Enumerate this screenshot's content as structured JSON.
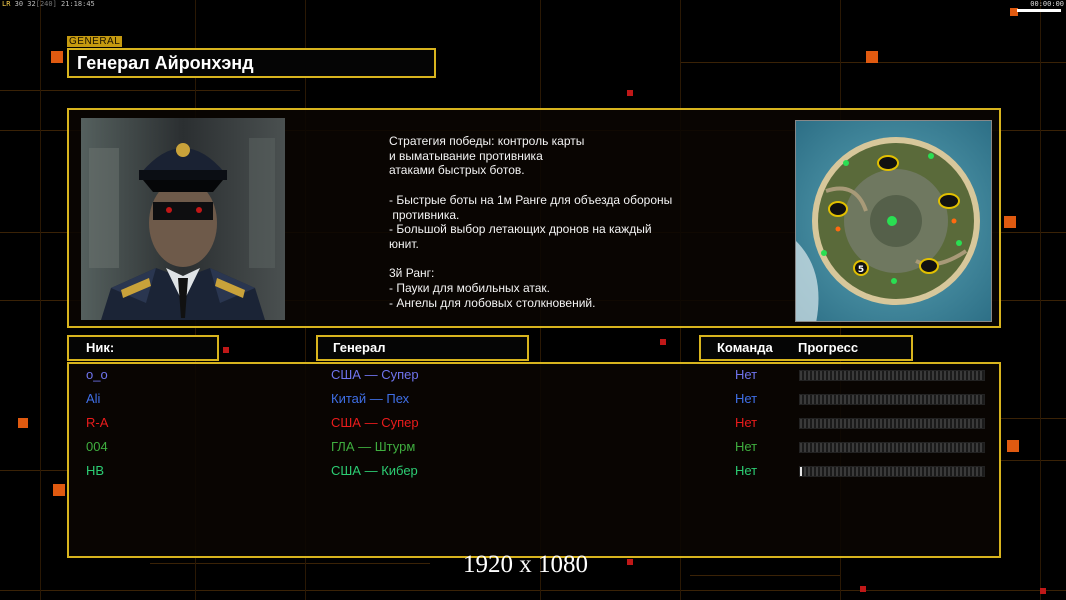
{
  "hud": {
    "left_lr": "LR",
    "left_fps": "30 32",
    "left_fps_dim": "[240]",
    "left_time": "21:18:45",
    "right_time": "00:00:00"
  },
  "general_tag": "GENERAL",
  "general_name": "Генерал Айронхэнд",
  "description": "Стратегия победы: контроль карты\nи выматывание противника\nатаками быстрых ботов.\n\n- Быстрые боты на 1м Ранге для объезда обороны\n противника.\n- Большой выбор летающих дронов на каждый\nюнит.\n\n3й Ранг:\n- Пауки для мобильных атак.\n- Ангелы для лобовых столкновений.",
  "minimap": {
    "marker_label": "5"
  },
  "headers": {
    "nick": "Ник:",
    "general": "Генерал",
    "team": "Команда",
    "progress": "Прогресс"
  },
  "players": [
    {
      "nick": "o_o",
      "general": "США — Супер",
      "team": "Нет",
      "progress": 0,
      "color": "#6f74ee"
    },
    {
      "nick": "Ali",
      "general": "Китай — Пех",
      "team": "Нет",
      "progress": 0,
      "color": "#3f6fe6"
    },
    {
      "nick": "R-A",
      "general": "США — Супер",
      "team": "Нет",
      "progress": 0,
      "color": "#ea1c1c"
    },
    {
      "nick": "004",
      "general": "ГЛА — Штурм",
      "team": "Нет",
      "progress": 0,
      "color": "#3fae3f"
    },
    {
      "nick": "HB",
      "general": "США — Кибер",
      "team": "Нет",
      "progress": 0.01,
      "color": "#2ccd73"
    }
  ],
  "resolution": "1920 x 1080",
  "colors": {
    "frame": "#d8b41e",
    "accent": "#e05a10"
  }
}
